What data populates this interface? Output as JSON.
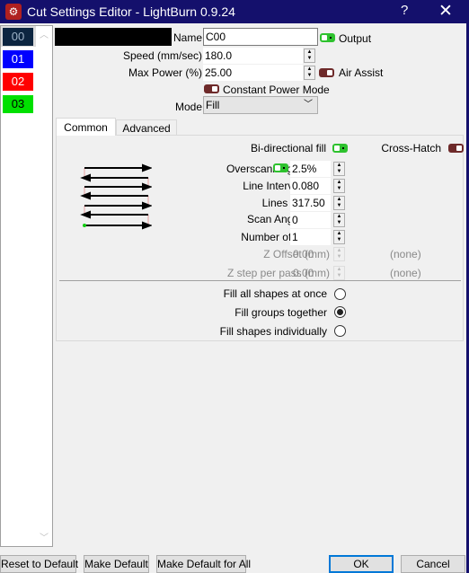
{
  "window": {
    "title": "Cut Settings Editor - LightBurn 0.9.24",
    "help": "?",
    "close": "✕"
  },
  "layers": [
    {
      "label": "00",
      "bg": "#0c2540",
      "fg": "#9fb4c8"
    },
    {
      "label": "01",
      "bg": "#0000ff",
      "fg": "#ffffff"
    },
    {
      "label": "02",
      "bg": "#ff0000",
      "fg": "#ffffff"
    },
    {
      "label": "03",
      "bg": "#00e000",
      "fg": "#000000"
    }
  ],
  "settings": {
    "name_label": "Name",
    "name_value": "C00",
    "output_label": "Output",
    "output_on": true,
    "speed_label": "Speed (mm/sec)",
    "speed_value": "180.0",
    "power_label": "Max Power (%)",
    "power_value": "25.00",
    "air_label": "Air Assist",
    "air_on": false,
    "cpm_label": "Constant Power Mode",
    "cpm_on": false,
    "mode_label": "Mode",
    "mode_value": "Fill"
  },
  "tabs": [
    {
      "label": "Common",
      "active": true
    },
    {
      "label": "Advanced",
      "active": false
    }
  ],
  "common": {
    "bidir_label": "Bi-directional fill",
    "bidir_on": true,
    "crosshatch_label": "Cross-Hatch",
    "crosshatch_on": false,
    "overscan_label": "Overscanning",
    "overscan_on": true,
    "overscan_value": "2.5%",
    "interval_label": "Line Interval (mm)",
    "interval_value": "0.080",
    "lpi_label": "Lines per Inch",
    "lpi_value": "317.50",
    "angle_label": "Scan Angle (deg)",
    "angle_value": "0",
    "passes_label": "Number of Passes",
    "passes_value": "1",
    "zoffset_label": "Z Offset (mm)",
    "zoffset_value": "0.00",
    "zoffset_note": "(none)",
    "zstep_label": "Z step per pass (mm)",
    "zstep_value": "0.00",
    "zstep_note": "(none)",
    "radios": [
      {
        "label": "Fill all shapes at once",
        "selected": false
      },
      {
        "label": "Fill groups together",
        "selected": true
      },
      {
        "label": "Fill shapes individually",
        "selected": false
      }
    ]
  },
  "buttons": {
    "reset": "Reset to Default",
    "make_default": "Make Default",
    "make_default_all": "Make Default for All",
    "ok": "OK",
    "cancel": "Cancel"
  }
}
